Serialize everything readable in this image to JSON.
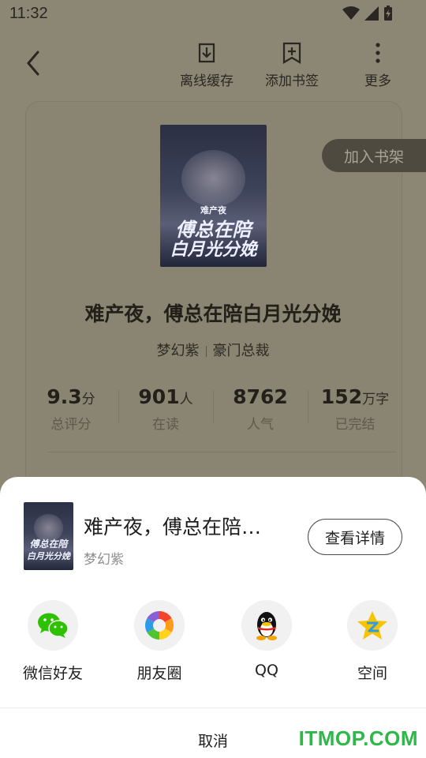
{
  "status": {
    "time": "11:32"
  },
  "toolbar": {
    "offline_label": "离线缓存",
    "bookmark_label": "添加书签",
    "more_label": "更多"
  },
  "book": {
    "add_shelf_label": "加入书架",
    "cover_small_caption": "难产夜",
    "cover_title_line1": "傅总在陪",
    "cover_title_line2": "白月光分娩",
    "title": "难产夜，傅总在陪白月光分娩",
    "author": "梦幻紫",
    "category": "豪门总裁",
    "stats": [
      {
        "value": "9.3",
        "unit": "分",
        "label": "总评分"
      },
      {
        "value": "901",
        "unit": "人",
        "label": "在读"
      },
      {
        "value": "8762",
        "unit": "",
        "label": "人气"
      },
      {
        "value": "152",
        "unit": "万字",
        "label": "已完结"
      }
    ]
  },
  "share_sheet": {
    "title": "难产夜，傅总在陪…",
    "author": "梦幻紫",
    "detail_button": "查看详情",
    "targets": [
      {
        "label": "微信好友",
        "icon": "wechat-icon"
      },
      {
        "label": "朋友圈",
        "icon": "moments-icon"
      },
      {
        "label": "QQ",
        "icon": "qq-icon"
      },
      {
        "label": "空间",
        "icon": "qzone-icon"
      }
    ],
    "cancel_label": "取消"
  },
  "watermark": "ITMOP.COM",
  "colors": {
    "wechat_green": "#2dc100",
    "watermark_green": "#2fb84a",
    "qzone_yellow": "#f7c400"
  }
}
